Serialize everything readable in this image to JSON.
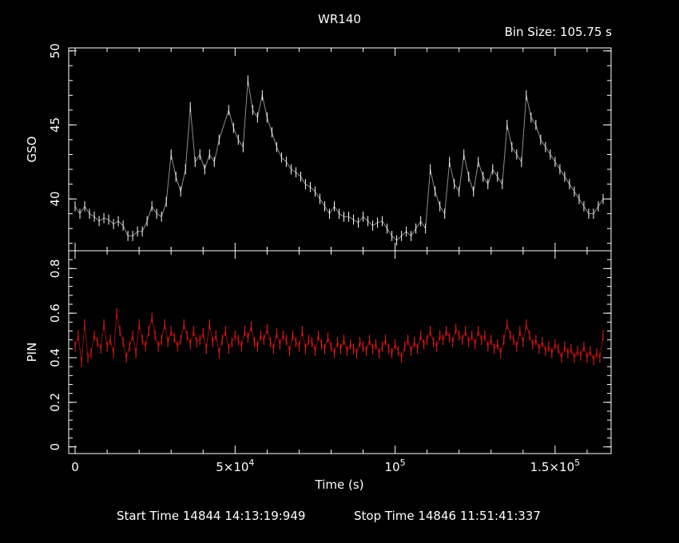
{
  "chart_data": {
    "type": "line",
    "title": "WR140",
    "bin_label": "Bin Size:  105.75  s",
    "footer": {
      "start": "Start Time 14844  14:13:19:949",
      "stop": "Stop Time 14846  11:51:41:337"
    },
    "xlabel": "Time (s)",
    "xlim": [
      -2000,
      167500
    ],
    "x_ticks": [
      {
        "value": 0,
        "text": "0",
        "exp": ""
      },
      {
        "value": 50000,
        "text": "5×10",
        "exp": "4"
      },
      {
        "value": 100000,
        "text": "10",
        "exp": "5"
      },
      {
        "value": 150000,
        "text": "1.5×10",
        "exp": "5"
      }
    ],
    "panels": [
      {
        "name": "GSO",
        "ylabel": "GSO",
        "ylim": [
          36.5,
          50.2
        ],
        "y_ticks": [
          {
            "value": 40,
            "text": "40"
          },
          {
            "value": 45,
            "text": "45"
          },
          {
            "value": 50,
            "text": "50"
          }
        ],
        "color": "#ffffff",
        "points": [
          [
            0,
            39.5
          ],
          [
            1500,
            39.0
          ],
          [
            3000,
            39.5
          ],
          [
            4500,
            39.0
          ],
          [
            6000,
            38.8
          ],
          [
            7500,
            38.5
          ],
          [
            9000,
            38.7
          ],
          [
            10500,
            38.6
          ],
          [
            12000,
            38.3
          ],
          [
            13500,
            38.5
          ],
          [
            15000,
            38.2
          ],
          [
            16500,
            37.5
          ],
          [
            18000,
            37.5
          ],
          [
            19500,
            37.8
          ],
          [
            21000,
            37.8
          ],
          [
            22500,
            38.5
          ],
          [
            24000,
            39.5
          ],
          [
            25500,
            39.0
          ],
          [
            27000,
            38.8
          ],
          [
            28500,
            39.8
          ],
          [
            30000,
            43.0
          ],
          [
            31500,
            41.5
          ],
          [
            33000,
            40.5
          ],
          [
            34500,
            42.0
          ],
          [
            36000,
            46.2
          ],
          [
            37500,
            42.5
          ],
          [
            39000,
            43.0
          ],
          [
            40500,
            42.0
          ],
          [
            42000,
            43.0
          ],
          [
            43500,
            42.5
          ],
          [
            45000,
            44.0
          ],
          [
            48000,
            46.0
          ],
          [
            49500,
            44.8
          ],
          [
            51000,
            44.0
          ],
          [
            52500,
            43.5
          ],
          [
            54000,
            48.0
          ],
          [
            55500,
            46.0
          ],
          [
            57000,
            45.5
          ],
          [
            58500,
            47.0
          ],
          [
            60000,
            45.5
          ],
          [
            61500,
            44.5
          ],
          [
            63000,
            43.5
          ],
          [
            64500,
            42.8
          ],
          [
            66000,
            42.5
          ],
          [
            67500,
            42.0
          ],
          [
            69000,
            41.8
          ],
          [
            70500,
            41.5
          ],
          [
            72000,
            41.0
          ],
          [
            73500,
            40.8
          ],
          [
            75000,
            40.5
          ],
          [
            76500,
            40.0
          ],
          [
            78000,
            39.5
          ],
          [
            79500,
            39.0
          ],
          [
            81000,
            39.5
          ],
          [
            82500,
            39.0
          ],
          [
            84000,
            38.8
          ],
          [
            85500,
            38.8
          ],
          [
            87000,
            38.6
          ],
          [
            88500,
            38.4
          ],
          [
            90000,
            38.8
          ],
          [
            91500,
            38.5
          ],
          [
            93000,
            38.2
          ],
          [
            94500,
            38.4
          ],
          [
            96000,
            38.5
          ],
          [
            97500,
            38.0
          ],
          [
            99000,
            37.5
          ],
          [
            100500,
            37.2
          ],
          [
            102000,
            37.5
          ],
          [
            103500,
            37.8
          ],
          [
            105000,
            37.5
          ],
          [
            106500,
            38.0
          ],
          [
            108000,
            38.5
          ],
          [
            109500,
            38.0
          ],
          [
            111000,
            42.0
          ],
          [
            112500,
            40.5
          ],
          [
            114000,
            39.5
          ],
          [
            115500,
            39.0
          ],
          [
            117000,
            42.5
          ],
          [
            118500,
            41.0
          ],
          [
            120000,
            40.5
          ],
          [
            121500,
            43.0
          ],
          [
            123000,
            41.5
          ],
          [
            124500,
            40.5
          ],
          [
            126000,
            42.5
          ],
          [
            127500,
            41.5
          ],
          [
            129000,
            41.0
          ],
          [
            130500,
            42.0
          ],
          [
            132000,
            41.5
          ],
          [
            133500,
            41.0
          ],
          [
            135000,
            45.0
          ],
          [
            136500,
            43.5
          ],
          [
            138000,
            43.0
          ],
          [
            139500,
            42.5
          ],
          [
            141000,
            47.0
          ],
          [
            142500,
            45.5
          ],
          [
            144000,
            45.0
          ],
          [
            145500,
            44.0
          ],
          [
            147000,
            43.5
          ],
          [
            148500,
            43.0
          ],
          [
            150000,
            42.5
          ],
          [
            151500,
            42.0
          ],
          [
            153000,
            41.5
          ],
          [
            154500,
            41.0
          ],
          [
            156000,
            40.5
          ],
          [
            157500,
            40.0
          ],
          [
            159000,
            39.5
          ],
          [
            160500,
            39.0
          ],
          [
            162000,
            39.0
          ],
          [
            163500,
            39.5
          ],
          [
            165000,
            40.0
          ]
        ]
      },
      {
        "name": "PIN",
        "ylabel": "PIN",
        "ylim": [
          -0.03,
          0.88
        ],
        "y_ticks": [
          {
            "value": 0,
            "text": "0"
          },
          {
            "value": 0.2,
            "text": "0.2"
          },
          {
            "value": 0.4,
            "text": "0.4"
          },
          {
            "value": 0.6,
            "text": "0.6"
          },
          {
            "value": 0.8,
            "text": "0.8"
          }
        ],
        "color": "#ff1a1a",
        "points": [
          [
            0,
            0.45
          ],
          [
            1000,
            0.5
          ],
          [
            2000,
            0.38
          ],
          [
            3000,
            0.55
          ],
          [
            4000,
            0.4
          ],
          [
            5000,
            0.42
          ],
          [
            6000,
            0.5
          ],
          [
            7000,
            0.47
          ],
          [
            8000,
            0.44
          ],
          [
            9000,
            0.55
          ],
          [
            10000,
            0.45
          ],
          [
            11000,
            0.48
          ],
          [
            12000,
            0.42
          ],
          [
            13000,
            0.6
          ],
          [
            14000,
            0.52
          ],
          [
            15000,
            0.47
          ],
          [
            16000,
            0.4
          ],
          [
            17000,
            0.45
          ],
          [
            18000,
            0.5
          ],
          [
            19000,
            0.42
          ],
          [
            20000,
            0.55
          ],
          [
            21000,
            0.48
          ],
          [
            22000,
            0.45
          ],
          [
            23000,
            0.52
          ],
          [
            24000,
            0.58
          ],
          [
            25000,
            0.5
          ],
          [
            26000,
            0.45
          ],
          [
            27000,
            0.48
          ],
          [
            28000,
            0.55
          ],
          [
            29000,
            0.47
          ],
          [
            30000,
            0.52
          ],
          [
            31000,
            0.49
          ],
          [
            32000,
            0.45
          ],
          [
            33000,
            0.48
          ],
          [
            34000,
            0.55
          ],
          [
            35000,
            0.5
          ],
          [
            36000,
            0.46
          ],
          [
            37000,
            0.52
          ],
          [
            38000,
            0.47
          ],
          [
            39000,
            0.48
          ],
          [
            40000,
            0.51
          ],
          [
            41000,
            0.44
          ],
          [
            42000,
            0.55
          ],
          [
            43000,
            0.47
          ],
          [
            44000,
            0.5
          ],
          [
            45000,
            0.42
          ],
          [
            46000,
            0.48
          ],
          [
            47000,
            0.52
          ],
          [
            48000,
            0.44
          ],
          [
            49000,
            0.47
          ],
          [
            50000,
            0.5
          ],
          [
            51000,
            0.48
          ],
          [
            52000,
            0.45
          ],
          [
            53000,
            0.52
          ],
          [
            54000,
            0.49
          ],
          [
            55000,
            0.54
          ],
          [
            56000,
            0.47
          ],
          [
            57000,
            0.45
          ],
          [
            58000,
            0.5
          ],
          [
            59000,
            0.48
          ],
          [
            60000,
            0.53
          ],
          [
            61000,
            0.47
          ],
          [
            62000,
            0.44
          ],
          [
            63000,
            0.51
          ],
          [
            64000,
            0.46
          ],
          [
            65000,
            0.5
          ],
          [
            66000,
            0.48
          ],
          [
            67000,
            0.43
          ],
          [
            68000,
            0.5
          ],
          [
            69000,
            0.47
          ],
          [
            70000,
            0.45
          ],
          [
            71000,
            0.52
          ],
          [
            72000,
            0.44
          ],
          [
            73000,
            0.48
          ],
          [
            74000,
            0.47
          ],
          [
            75000,
            0.43
          ],
          [
            76000,
            0.5
          ],
          [
            77000,
            0.46
          ],
          [
            78000,
            0.44
          ],
          [
            79000,
            0.49
          ],
          [
            80000,
            0.45
          ],
          [
            81000,
            0.42
          ],
          [
            82000,
            0.47
          ],
          [
            83000,
            0.44
          ],
          [
            84000,
            0.48
          ],
          [
            85000,
            0.43
          ],
          [
            86000,
            0.46
          ],
          [
            87000,
            0.44
          ],
          [
            88000,
            0.42
          ],
          [
            89000,
            0.47
          ],
          [
            90000,
            0.45
          ],
          [
            91000,
            0.43
          ],
          [
            92000,
            0.48
          ],
          [
            93000,
            0.44
          ],
          [
            94000,
            0.46
          ],
          [
            95000,
            0.42
          ],
          [
            96000,
            0.45
          ],
          [
            97000,
            0.48
          ],
          [
            98000,
            0.44
          ],
          [
            99000,
            0.42
          ],
          [
            100000,
            0.46
          ],
          [
            101000,
            0.43
          ],
          [
            102000,
            0.4
          ],
          [
            103000,
            0.45
          ],
          [
            104000,
            0.48
          ],
          [
            105000,
            0.43
          ],
          [
            106000,
            0.47
          ],
          [
            107000,
            0.44
          ],
          [
            108000,
            0.5
          ],
          [
            109000,
            0.46
          ],
          [
            110000,
            0.48
          ],
          [
            111000,
            0.52
          ],
          [
            112000,
            0.47
          ],
          [
            113000,
            0.45
          ],
          [
            114000,
            0.5
          ],
          [
            115000,
            0.48
          ],
          [
            116000,
            0.52
          ],
          [
            117000,
            0.49
          ],
          [
            118000,
            0.47
          ],
          [
            119000,
            0.53
          ],
          [
            120000,
            0.5
          ],
          [
            121000,
            0.48
          ],
          [
            122000,
            0.52
          ],
          [
            123000,
            0.47
          ],
          [
            124000,
            0.5
          ],
          [
            125000,
            0.46
          ],
          [
            126000,
            0.52
          ],
          [
            127000,
            0.48
          ],
          [
            128000,
            0.5
          ],
          [
            129000,
            0.45
          ],
          [
            130000,
            0.48
          ],
          [
            131000,
            0.44
          ],
          [
            132000,
            0.46
          ],
          [
            133000,
            0.42
          ],
          [
            134000,
            0.48
          ],
          [
            135000,
            0.55
          ],
          [
            136000,
            0.5
          ],
          [
            137000,
            0.48
          ],
          [
            138000,
            0.45
          ],
          [
            139000,
            0.52
          ],
          [
            140000,
            0.47
          ],
          [
            141000,
            0.55
          ],
          [
            142000,
            0.5
          ],
          [
            143000,
            0.46
          ],
          [
            144000,
            0.48
          ],
          [
            145000,
            0.44
          ],
          [
            146000,
            0.47
          ],
          [
            147000,
            0.43
          ],
          [
            148000,
            0.45
          ],
          [
            149000,
            0.42
          ],
          [
            150000,
            0.46
          ],
          [
            151000,
            0.44
          ],
          [
            152000,
            0.4
          ],
          [
            153000,
            0.45
          ],
          [
            154000,
            0.42
          ],
          [
            155000,
            0.44
          ],
          [
            156000,
            0.4
          ],
          [
            157000,
            0.43
          ],
          [
            158000,
            0.41
          ],
          [
            159000,
            0.45
          ],
          [
            160000,
            0.4
          ],
          [
            161000,
            0.43
          ],
          [
            162000,
            0.39
          ],
          [
            163000,
            0.42
          ],
          [
            164000,
            0.4
          ],
          [
            165000,
            0.5
          ]
        ]
      }
    ]
  }
}
